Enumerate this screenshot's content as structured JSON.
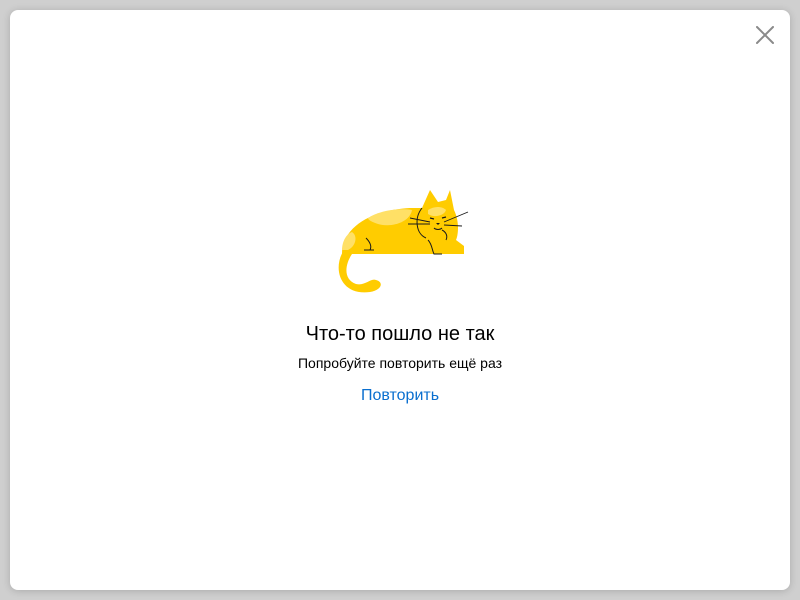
{
  "dialog": {
    "title": "Что-то пошло не так",
    "subtitle": "Попробуйте повторить ещё раз",
    "retry_label": "Повторить",
    "close_icon": "close-icon",
    "illustration": "cat-illustration"
  },
  "colors": {
    "accent_link": "#0a6fcf",
    "cat_primary": "#ffcc00",
    "cat_spots": "#ffe066"
  }
}
